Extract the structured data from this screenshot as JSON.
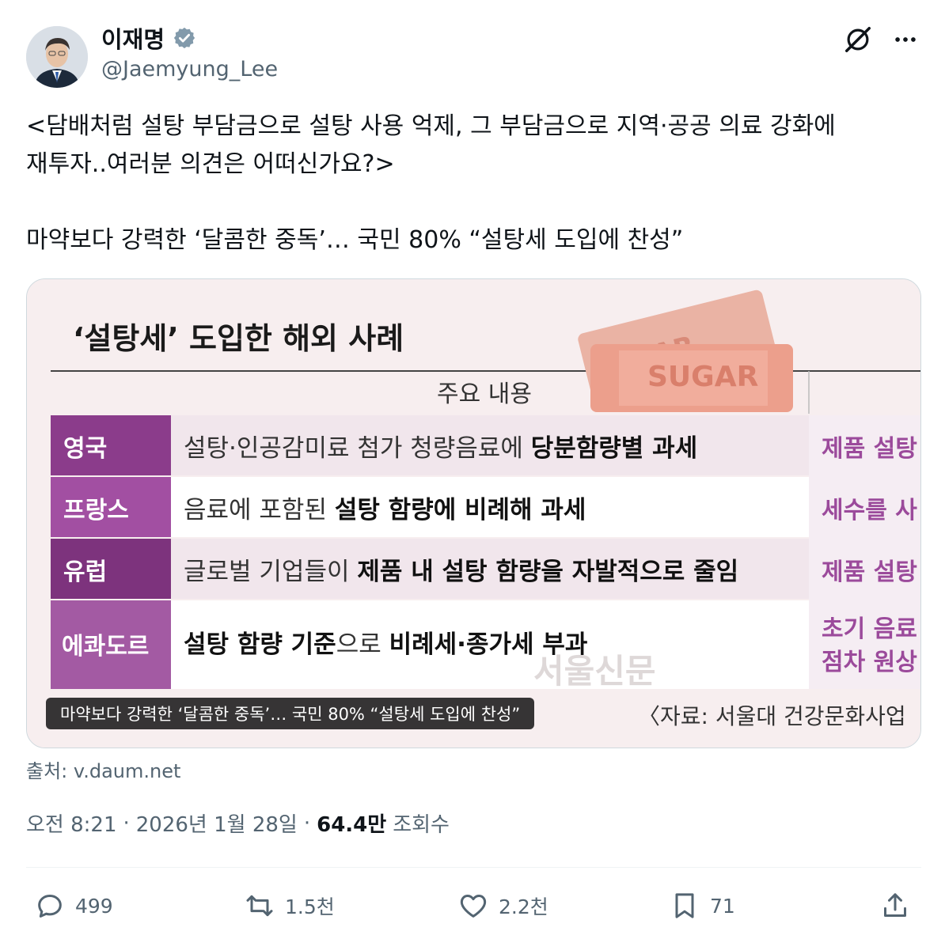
{
  "author": {
    "name": "이재명",
    "handle": "@Jaemyung_Lee"
  },
  "tweet": {
    "text": "<담배처럼 설탕 부담금으로 설탕 사용 억제, 그 부담금으로 지역·공공 의료 강화에\n재투자..여러분 의견은 어떠신가요?>\n\n마약보다 강력한 ‘달콤한 중독’… 국민 80% “설탕세 도입에 찬성”"
  },
  "card": {
    "heading": "‘설탕세’ 도입한 해외 사례",
    "column_header": "주요 내용",
    "sugar_label": "SUGAR",
    "sugar_label_back": "GAR",
    "watermark": "서울신문",
    "source_note": "〈자료: 서울대 건강문화사업",
    "caption": "마약보다 강력한 ‘달콤한 중독’… 국민 80% “설탕세 도입에 찬성”",
    "rows": [
      {
        "country": "영국",
        "plain": "설탕·인공감미료 첨가 청량음료에 ",
        "bold": "당분함량별 과세",
        "right": "제품 설탕"
      },
      {
        "country": "프랑스",
        "plain": "음료에 포함된 ",
        "bold": "설탕 함량에 비례해 과세",
        "right": "세수를 사"
      },
      {
        "country": "유럽",
        "plain": "글로벌 기업들이 ",
        "bold": "제품 내 설탕 함량을 자발적으로 줄임",
        "right": "제품 설탕"
      },
      {
        "country": "에콰도르",
        "bold_a": "설탕 함량 기준",
        "plain_a": "으로 ",
        "bold_b": "비례세·종가세 부과",
        "right_1": "초기 음료",
        "right_2": "점차 원상"
      }
    ]
  },
  "source": "출처: v.daum.net",
  "meta": {
    "time": "오전 8:21",
    "date": "2026년 1월 28일",
    "views": "64.4만",
    "views_label": "조회수"
  },
  "actions": {
    "replies": "499",
    "reposts": "1.5천",
    "likes": "2.2천",
    "bookmarks": "71"
  },
  "colors": {
    "country_cell": "#8b3c8b",
    "card_bg": "#f7eeef",
    "right_text": "#9b4a9b",
    "sugar_pack": "#e8a08f"
  }
}
